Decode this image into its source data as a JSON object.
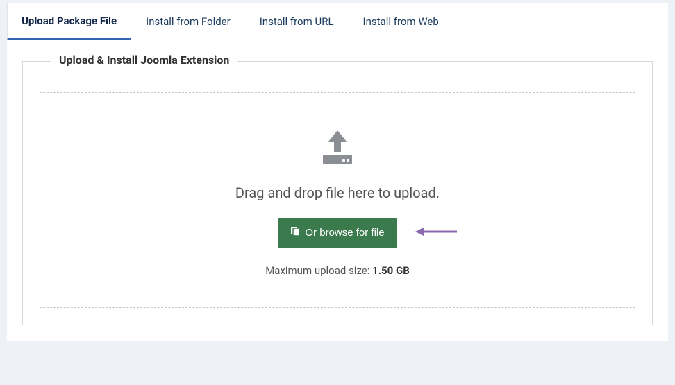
{
  "tabs": [
    {
      "label": "Upload Package File",
      "active": true
    },
    {
      "label": "Install from Folder",
      "active": false
    },
    {
      "label": "Install from URL",
      "active": false
    },
    {
      "label": "Install from Web",
      "active": false
    }
  ],
  "fieldset": {
    "legend": "Upload & Install Joomla Extension"
  },
  "dropzone": {
    "drag_text": "Drag and drop file here to upload.",
    "browse_label": "Or browse for file",
    "max_size_prefix": "Maximum upload size: ",
    "max_size_value": "1.50 GB"
  }
}
